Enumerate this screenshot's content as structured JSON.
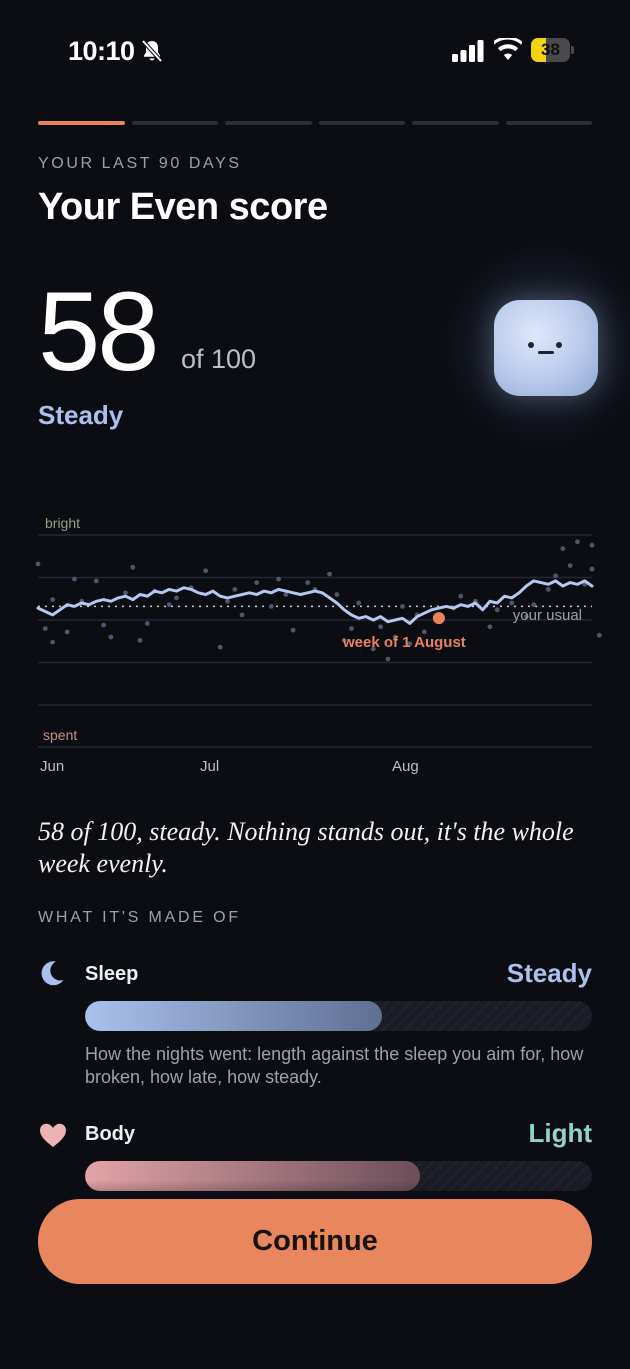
{
  "status_bar": {
    "time": "10:10",
    "battery": "38",
    "battery_level": 0.38
  },
  "onboarding": {
    "total_steps": 6,
    "current_step": 1
  },
  "header": {
    "eyebrow": "YOUR LAST 90 DAYS",
    "title": "Your Even score"
  },
  "score": {
    "value": "58",
    "out_of": "of 100",
    "state": "Steady"
  },
  "chart_data": {
    "type": "line",
    "x_tick_labels": [
      "Jun",
      "Jul",
      "Aug"
    ],
    "top_label": "bright",
    "bottom_label": "spent",
    "reference_line_label": "your usual",
    "highlight_label": "week of 1 August",
    "ylim": [
      0,
      100
    ],
    "usual": 58,
    "highlight_index": 55,
    "series": [
      {
        "values": [
          57,
          55,
          53,
          56,
          59,
          58,
          60,
          59,
          61,
          62,
          61,
          63,
          64,
          62,
          65,
          64,
          67,
          66,
          68,
          67,
          69,
          68,
          66,
          65,
          67,
          64,
          63,
          64,
          65,
          66,
          65,
          67,
          66,
          68,
          67,
          66,
          65,
          66,
          67,
          66,
          63,
          60,
          56,
          53,
          51,
          52,
          50,
          52,
          49,
          50,
          51,
          48,
          52,
          54,
          56,
          57,
          58,
          57,
          59,
          58,
          60,
          56,
          61,
          60,
          64,
          63,
          66,
          70,
          73,
          72,
          71,
          73,
          70,
          72,
          71,
          73,
          70
        ]
      }
    ],
    "scatter": [
      {
        "x": 0,
        "y": 83
      },
      {
        "x": 1,
        "y": 45
      },
      {
        "x": 2,
        "y": 37
      },
      {
        "x": 2,
        "y": 62
      },
      {
        "x": 4,
        "y": 43
      },
      {
        "x": 5,
        "y": 74
      },
      {
        "x": 6,
        "y": 61
      },
      {
        "x": 8,
        "y": 73
      },
      {
        "x": 9,
        "y": 47
      },
      {
        "x": 10,
        "y": 40
      },
      {
        "x": 12,
        "y": 66
      },
      {
        "x": 13,
        "y": 81
      },
      {
        "x": 14,
        "y": 38
      },
      {
        "x": 15,
        "y": 48
      },
      {
        "x": 16,
        "y": 67
      },
      {
        "x": 18,
        "y": 59
      },
      {
        "x": 19,
        "y": 63
      },
      {
        "x": 21,
        "y": 69
      },
      {
        "x": 23,
        "y": 79
      },
      {
        "x": 25,
        "y": 34
      },
      {
        "x": 26,
        "y": 61
      },
      {
        "x": 27,
        "y": 68
      },
      {
        "x": 28,
        "y": 53
      },
      {
        "x": 30,
        "y": 72
      },
      {
        "x": 32,
        "y": 58
      },
      {
        "x": 33,
        "y": 74
      },
      {
        "x": 34,
        "y": 65
      },
      {
        "x": 35,
        "y": 44
      },
      {
        "x": 37,
        "y": 72
      },
      {
        "x": 38,
        "y": 68
      },
      {
        "x": 40,
        "y": 77
      },
      {
        "x": 41,
        "y": 65
      },
      {
        "x": 42,
        "y": 38
      },
      {
        "x": 43,
        "y": 45
      },
      {
        "x": 44,
        "y": 60
      },
      {
        "x": 46,
        "y": 33
      },
      {
        "x": 47,
        "y": 46
      },
      {
        "x": 48,
        "y": 27
      },
      {
        "x": 49,
        "y": 40
      },
      {
        "x": 50,
        "y": 58
      },
      {
        "x": 51,
        "y": 36
      },
      {
        "x": 52,
        "y": 53
      },
      {
        "x": 53,
        "y": 43
      },
      {
        "x": 55,
        "y": 51
      },
      {
        "x": 57,
        "y": 57
      },
      {
        "x": 58,
        "y": 64
      },
      {
        "x": 60,
        "y": 61
      },
      {
        "x": 62,
        "y": 46
      },
      {
        "x": 63,
        "y": 56
      },
      {
        "x": 65,
        "y": 60
      },
      {
        "x": 67,
        "y": 52
      },
      {
        "x": 68,
        "y": 59
      },
      {
        "x": 70,
        "y": 68
      },
      {
        "x": 71,
        "y": 76
      },
      {
        "x": 72,
        "y": 92
      },
      {
        "x": 73,
        "y": 82
      },
      {
        "x": 74,
        "y": 96
      },
      {
        "x": 75,
        "y": 71
      },
      {
        "x": 76,
        "y": 94
      },
      {
        "x": 76,
        "y": 80
      },
      {
        "x": 77,
        "y": 41
      }
    ]
  },
  "summary": "58 of 100, steady. Nothing stands out, it's the whole week evenly.",
  "breakdown": {
    "heading": "WHAT IT'S MADE OF",
    "components": [
      {
        "name": "Sleep",
        "level": "Steady",
        "level_color": "#a9c1ec",
        "fill_fraction": 0.585,
        "fill_gradient": [
          "#a9c1ec",
          "#5e6f92"
        ],
        "icon": "moon-icon",
        "description": "How the nights went: length against the sleep you aim for, how broken, how late, how steady."
      },
      {
        "name": "Body",
        "level": "Light",
        "level_color": "#8fd6c4",
        "fill_fraction": 0.66,
        "fill_gradient": [
          "#e3a4a7",
          "#6b4e5a"
        ],
        "icon": "heart-icon"
      }
    ]
  },
  "cta": {
    "label": "Continue"
  }
}
